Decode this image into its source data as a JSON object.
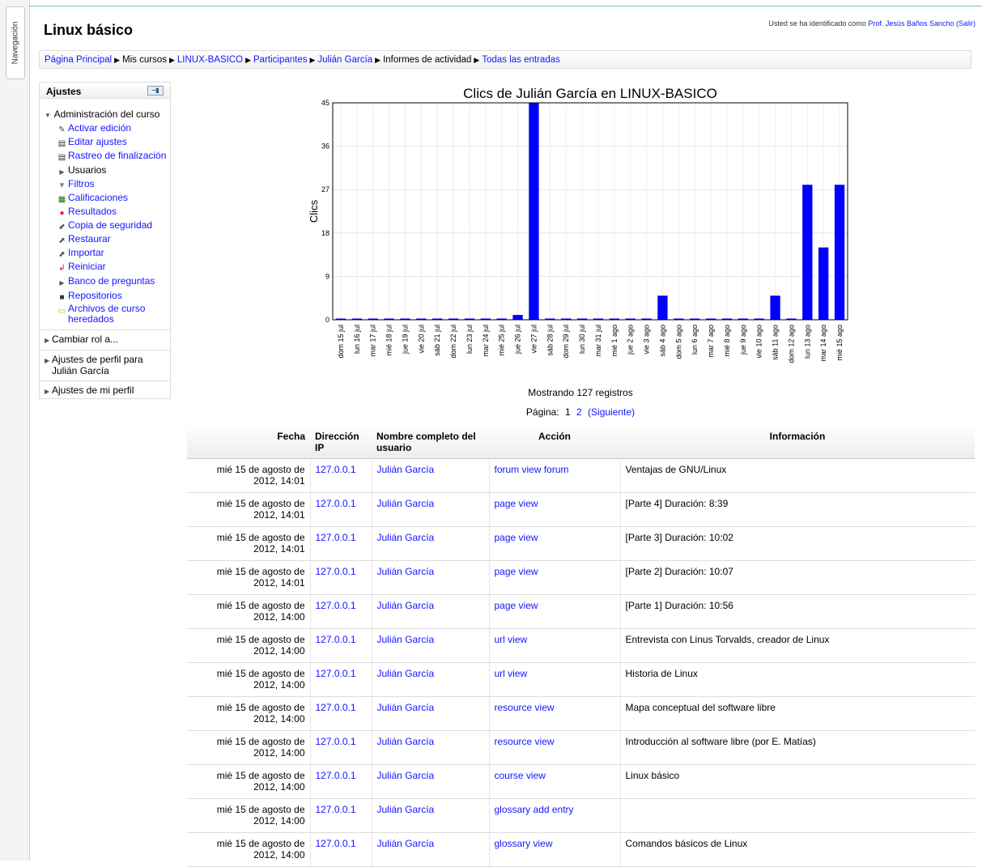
{
  "nav": {
    "tab_label": "Navegación"
  },
  "header": {
    "login_prefix": "Usted se ha identificado como",
    "user_link": "Prof. Jesús Baños Sancho",
    "logout_link": "(Salir)",
    "course_title": "Linux básico"
  },
  "breadcrumb": [
    {
      "label": "Página Principal",
      "link": true
    },
    {
      "label": "Mis cursos",
      "link": false
    },
    {
      "label": "LINUX-BASICO",
      "link": true
    },
    {
      "label": "Participantes",
      "link": true
    },
    {
      "label": "Julián García",
      "link": true
    },
    {
      "label": "Informes de actividad",
      "link": false
    },
    {
      "label": "Todas las entradas",
      "link": true
    }
  ],
  "settings": {
    "title": "Ajustes",
    "admin_label": "Administración del curso",
    "items": [
      {
        "label": "Activar edición",
        "icon": "pencil-icon",
        "link": true
      },
      {
        "label": "Editar ajustes",
        "icon": "document-icon",
        "link": true
      },
      {
        "label": "Rastreo de finalización",
        "icon": "document-icon",
        "link": true
      },
      {
        "label": "Usuarios",
        "icon": "triangle-right-icon",
        "link": false
      },
      {
        "label": "Filtros",
        "icon": "filter-icon",
        "link": true
      },
      {
        "label": "Calificaciones",
        "icon": "grid-icon",
        "link": true
      },
      {
        "label": "Resultados",
        "icon": "results-icon",
        "link": true
      },
      {
        "label": "Copia de seguridad",
        "icon": "backup-icon",
        "link": true
      },
      {
        "label": "Restaurar",
        "icon": "restore-icon",
        "link": true
      },
      {
        "label": "Importar",
        "icon": "import-icon",
        "link": true
      },
      {
        "label": "Reiniciar",
        "icon": "reset-icon",
        "link": true
      },
      {
        "label": "Banco de preguntas",
        "icon": "triangle-right-icon",
        "link": true
      },
      {
        "label": "Repositorios",
        "icon": "repository-icon",
        "link": true
      },
      {
        "label": "Archivos de curso heredados",
        "icon": "folder-icon",
        "link": true
      }
    ],
    "sections": [
      "Cambiar rol a...",
      "Ajustes de perfil para Julián García",
      "Ajustes de mi perfil"
    ]
  },
  "chart_data": {
    "type": "bar",
    "title": "Clics de Julián García en LINUX-BASICO",
    "xlabel": "",
    "ylabel": "Clics",
    "ylim": [
      0,
      45
    ],
    "yticks": [
      0,
      9,
      18,
      27,
      36,
      45
    ],
    "grid": true,
    "bar_color": "#0000ff",
    "categories": [
      "dom 15 jul",
      "lun 16 jul",
      "mar 17 jul",
      "mié 18 jul",
      "jue 19 jul",
      "vie 20 jul",
      "sáb 21 jul",
      "dom 22 jul",
      "lun 23 jul",
      "mar 24 jul",
      "mié 25 jul",
      "jue 26 jul",
      "vie 27 jul",
      "sáb 28 jul",
      "dom 29 jul",
      "lun 30 jul",
      "mar 31 jul",
      "mié 1 ago",
      "jue 2 ago",
      "vie 3 ago",
      "sáb 4 ago",
      "dom 5 ago",
      "lun 6 ago",
      "mar 7 ago",
      "mié 8 ago",
      "jue 9 ago",
      "vie 10 ago",
      "sáb 11 ago",
      "dom 12 ago",
      "lun 13 ago",
      "mar 14 ago",
      "mié 15 ago"
    ],
    "values": [
      0,
      0,
      0,
      0,
      0,
      0,
      0,
      0,
      0,
      0,
      0,
      1,
      45,
      0,
      0,
      0,
      0,
      0,
      0,
      0,
      5,
      0,
      0,
      0,
      0,
      0,
      0,
      5,
      0,
      28,
      15,
      28
    ]
  },
  "status": {
    "count_text": "Mostrando 127 registros",
    "page_label": "Página:",
    "page_current": "1",
    "page_2": "2",
    "next_label": "(Siguiente)"
  },
  "table": {
    "headers": [
      "Fecha",
      "Dirección IP",
      "Nombre completo del usuario",
      "Acción",
      "Información"
    ],
    "rows": [
      {
        "date": "mié 15 de agosto de 2012, 14:01",
        "ip": "127.0.0.1",
        "name": "Julián García",
        "action": "forum view forum",
        "info": "Ventajas de GNU/Linux"
      },
      {
        "date": "mié 15 de agosto de 2012, 14:01",
        "ip": "127.0.0.1",
        "name": "Julián García",
        "action": "page view",
        "info": "[Parte 4] Duración: 8:39"
      },
      {
        "date": "mié 15 de agosto de 2012, 14:01",
        "ip": "127.0.0.1",
        "name": "Julián García",
        "action": "page view",
        "info": "[Parte 3] Duración: 10:02"
      },
      {
        "date": "mié 15 de agosto de 2012, 14:01",
        "ip": "127.0.0.1",
        "name": "Julián García",
        "action": "page view",
        "info": "[Parte 2] Duración: 10:07"
      },
      {
        "date": "mié 15 de agosto de 2012, 14:00",
        "ip": "127.0.0.1",
        "name": "Julián García",
        "action": "page view",
        "info": "[Parte 1] Duración: 10:56"
      },
      {
        "date": "mié 15 de agosto de 2012, 14:00",
        "ip": "127.0.0.1",
        "name": "Julián García",
        "action": "url view",
        "info": "Entrevista con Linus Torvalds, creador de Linux"
      },
      {
        "date": "mié 15 de agosto de 2012, 14:00",
        "ip": "127.0.0.1",
        "name": "Julián García",
        "action": "url view",
        "info": "Historia de Linux"
      },
      {
        "date": "mié 15 de agosto de 2012, 14:00",
        "ip": "127.0.0.1",
        "name": "Julián García",
        "action": "resource view",
        "info": "Mapa conceptual del software libre"
      },
      {
        "date": "mié 15 de agosto de 2012, 14:00",
        "ip": "127.0.0.1",
        "name": "Julián García",
        "action": "resource view",
        "info": "Introducción al software libre (por E. Matías)"
      },
      {
        "date": "mié 15 de agosto de 2012, 14:00",
        "ip": "127.0.0.1",
        "name": "Julián García",
        "action": "course view",
        "info": "Linux básico"
      },
      {
        "date": "mié 15 de agosto de 2012, 14:00",
        "ip": "127.0.0.1",
        "name": "Julián García",
        "action": "glossary add entry",
        "info": ""
      },
      {
        "date": "mié 15 de agosto de 2012, 14:00",
        "ip": "127.0.0.1",
        "name": "Julián García",
        "action": "glossary view",
        "info": "Comandos básicos de Linux"
      }
    ]
  }
}
